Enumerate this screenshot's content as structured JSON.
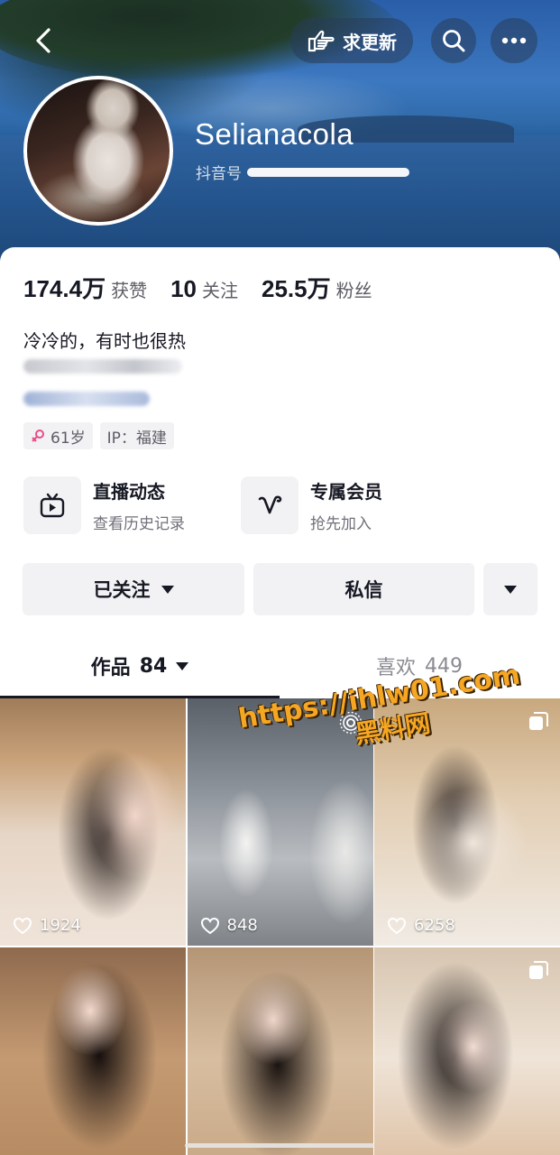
{
  "header": {
    "update_label": "求更新",
    "username": "Selianacola",
    "douyin_id_label": "抖音号"
  },
  "stats": {
    "likes_num": "174.4万",
    "likes_label": "获赞",
    "following_num": "10",
    "following_label": "关注",
    "followers_num": "25.5万",
    "followers_label": "粉丝"
  },
  "bio": {
    "line1": "冷冷的，有时也很热"
  },
  "tags": {
    "age": "61岁",
    "ip": "IP：福建"
  },
  "features": {
    "live_title": "直播动态",
    "live_sub": "查看历史记录",
    "member_title": "专属会员",
    "member_sub": "抢先加入"
  },
  "actions": {
    "followed": "已关注",
    "message": "私信"
  },
  "tabs": {
    "works_label": "作品",
    "works_count": "84",
    "likes_label": "喜欢",
    "likes_count": "449"
  },
  "videos": [
    {
      "likes": "1924"
    },
    {
      "likes": "848"
    },
    {
      "likes": "6258"
    },
    {
      "likes": ""
    },
    {
      "likes": ""
    },
    {
      "likes": ""
    }
  ],
  "watermark": {
    "url": "https://ihlw01.com",
    "name": "黑料网"
  },
  "colors": {
    "text_primary": "#161823",
    "text_secondary": "#5d5e66",
    "button_bg": "#f2f2f4",
    "watermark": "#f5a623",
    "female_icon": "#e94c8a"
  }
}
